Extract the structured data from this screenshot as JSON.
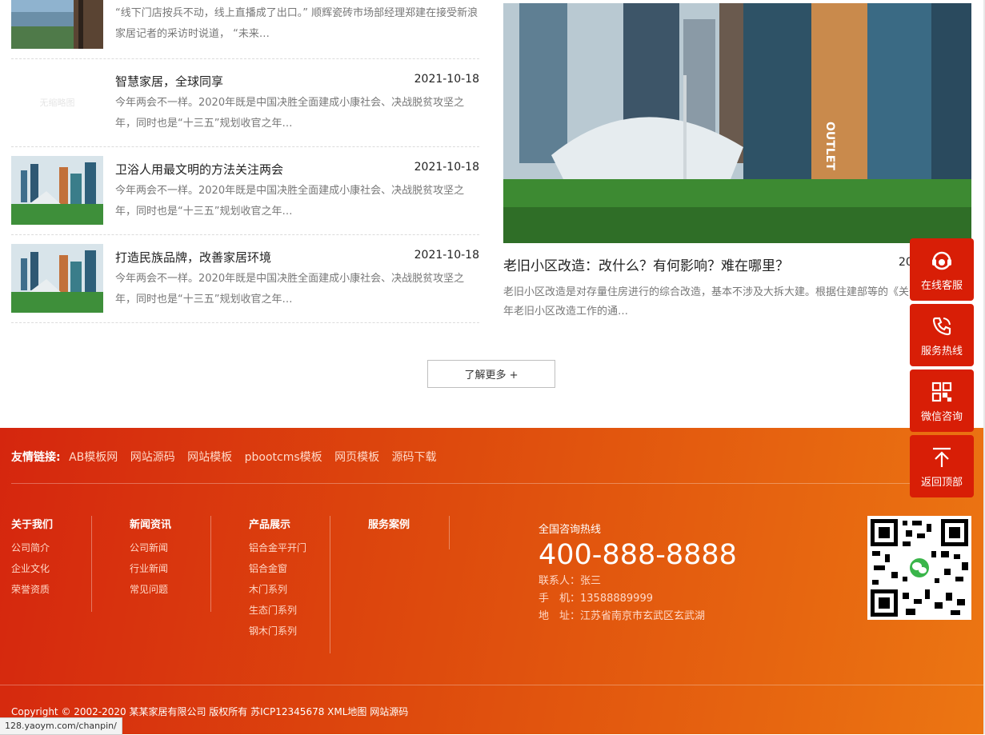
{
  "news": [
    {
      "title": "",
      "date": "",
      "desc": "“线下门店按兵不动，线上直播成了出口。” 顺辉瓷砖市场部经理郑建在接受新浪家居记者的采访时说道， “未来…",
      "thumb": "landscape"
    },
    {
      "title": "智慧家居，全球同享",
      "date": "2021-10-18",
      "desc": "今年两会不一样。2020年既是中国决胜全面建成小康社会、决战脱贫攻坚之年，同时也是“十三五”规划收官之年…",
      "thumb": "placeholder",
      "placeholder_text": "无缩略图"
    },
    {
      "title": "卫浴人用最文明的方法关注两会",
      "date": "2021-10-18",
      "desc": "今年两会不一样。2020年既是中国决胜全面建成小康社会、决战脱贫攻坚之年，同时也是“十三五”规划收官之年…",
      "thumb": "city"
    },
    {
      "title": "打造民族品牌，改善家居环境",
      "date": "2021-10-18",
      "desc": "今年两会不一样。2020年既是中国决胜全面建成小康社会、决战脱贫攻坚之年，同时也是“十三五”规划收官之年…",
      "thumb": "city"
    }
  ],
  "featured": {
    "title": "老旧小区改造：改什么？有何影响？难在哪里？",
    "date": "20",
    "desc": "老旧小区改造是对存量住房进行的综合改造，基本不涉及大拆大建。根据住建部等的《关于做好2019年老旧小区改造工作的通…",
    "sign_text": "OUTLET"
  },
  "more_button": "了解更多 +",
  "footer": {
    "links_label": "友情链接:",
    "links": [
      "AB模板网",
      "网站源码",
      "网站模板",
      "pbootcms模板",
      "网页模板",
      "源码下载"
    ],
    "columns": [
      {
        "head": "关于我们",
        "items": [
          "公司简介",
          "企业文化",
          "荣誉资质"
        ]
      },
      {
        "head": "新闻资讯",
        "items": [
          "公司新闻",
          "行业新闻",
          "常见问题"
        ]
      },
      {
        "head": "产品展示",
        "items": [
          "铝合金平开门",
          "铝合金窗",
          "木门系列",
          "生态门系列",
          "钢木门系列"
        ]
      },
      {
        "head": "服务案例",
        "items": []
      }
    ],
    "hotline_label": "全国咨询热线",
    "hotline": "400-888-8888",
    "contact_person": "联系人：张三",
    "mobile": "手　机：13588889999",
    "address": "地　址：江苏省南京市玄武区玄武湖",
    "copyright": "Copyright © 2002-2020 某某家居有限公司 版权所有 苏ICP12345678 XML地图 网站源码"
  },
  "side_buttons": [
    {
      "label": "在线客服",
      "icon": "headset-icon"
    },
    {
      "label": "服务热线",
      "icon": "phone-icon"
    },
    {
      "label": "微信咨询",
      "icon": "qrcode-icon"
    },
    {
      "label": "返回顶部",
      "icon": "arrow-up-icon"
    }
  ],
  "status_url": "128.yaoym.com/chanpin/",
  "colors": {
    "accent": "#d81e06",
    "footer_start": "#d5260e",
    "footer_end": "#ec7612"
  }
}
